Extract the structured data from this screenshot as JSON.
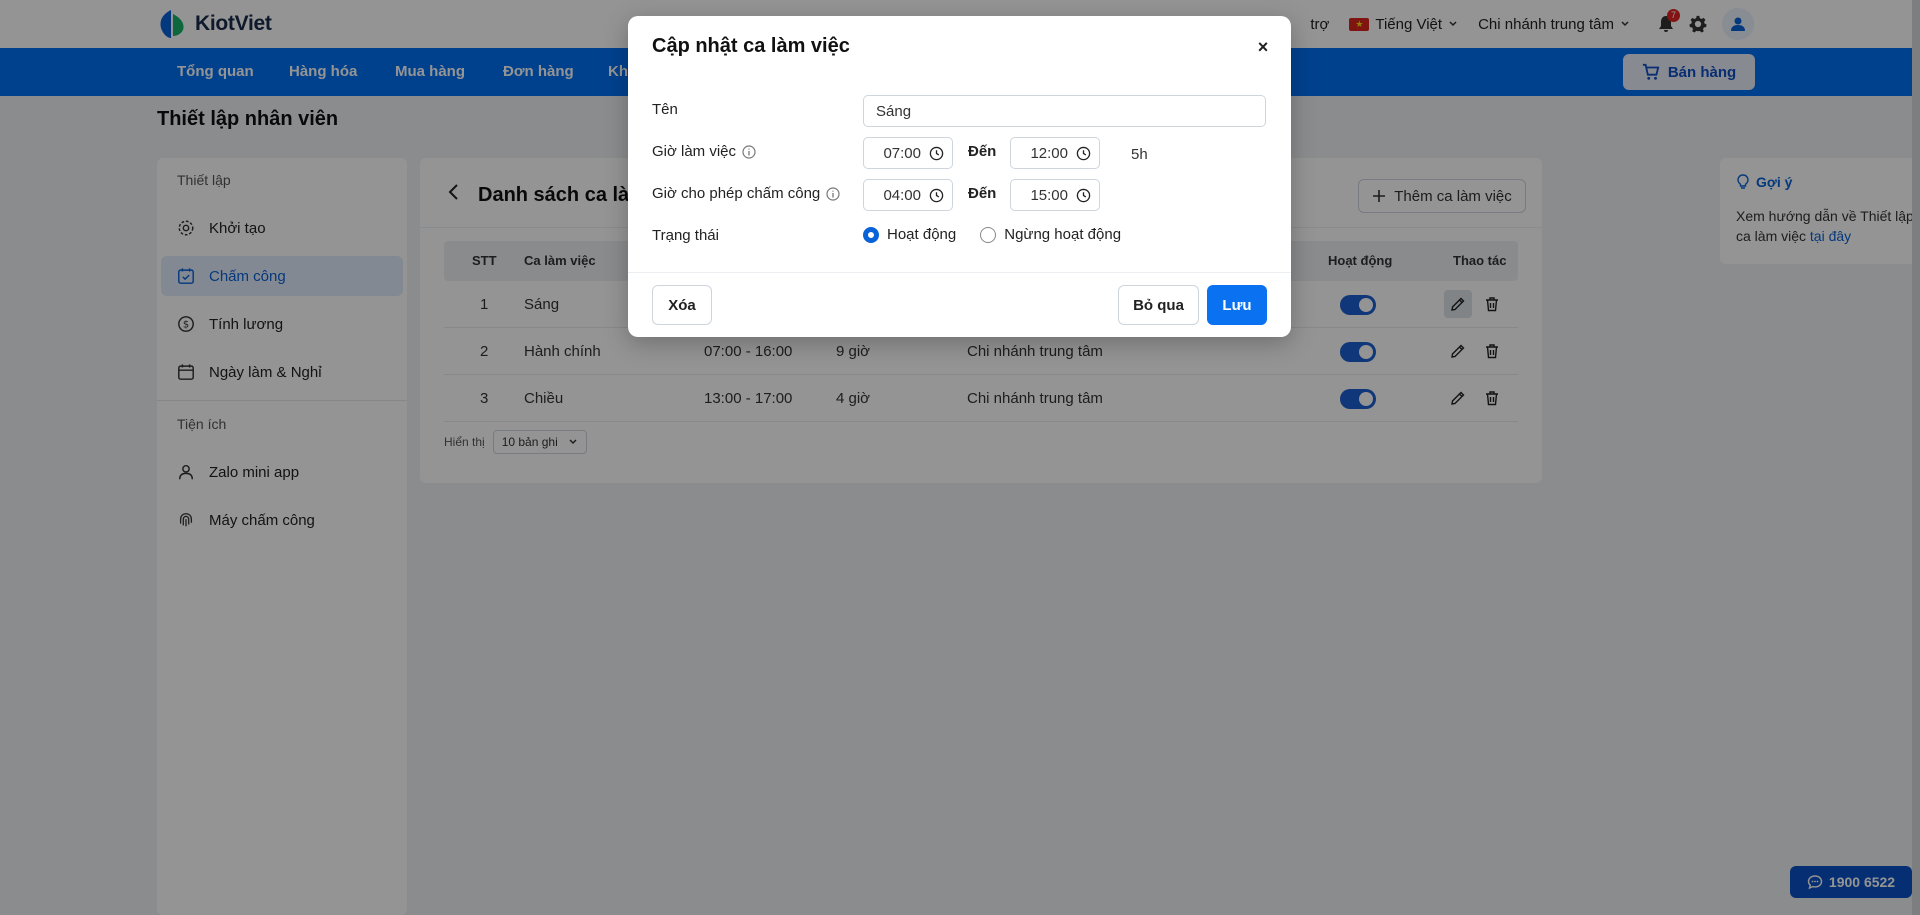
{
  "header": {
    "logo_text": "KiotViet",
    "support_label": "trợ",
    "language_label": "Tiếng Việt",
    "branch_label": "Chi nhánh trung tâm",
    "notification_count": "7"
  },
  "nav": {
    "items": [
      "Tổng quan",
      "Hàng hóa",
      "Mua hàng",
      "Đơn hàng",
      "Khá"
    ],
    "sell_label": "Bán hàng"
  },
  "page": {
    "title": "Thiết lập nhân viên"
  },
  "sidebar": {
    "section1": "Thiết lập",
    "items": [
      "Khởi tạo",
      "Chấm công",
      "Tính lương",
      "Ngày làm & Nghỉ"
    ],
    "section2": "Tiện ích",
    "utilities": [
      "Zalo mini app",
      "Máy chấm công"
    ]
  },
  "main": {
    "title": "Danh sách ca làm",
    "add_label": "Thêm ca làm việc",
    "columns": {
      "stt": "STT",
      "shift": "Ca làm việc",
      "active": "Hoạt động",
      "actions": "Thao tác"
    },
    "rows": [
      {
        "stt": "1",
        "name": "Sáng",
        "time": "",
        "hours": "",
        "branch": ""
      },
      {
        "stt": "2",
        "name": "Hành chính",
        "time": "07:00 - 16:00",
        "hours": "9 giờ",
        "branch": "Chi nhánh trung tâm"
      },
      {
        "stt": "3",
        "name": "Chiều",
        "time": "13:00 - 17:00",
        "hours": "4 giờ",
        "branch": "Chi nhánh trung tâm"
      }
    ],
    "pager_label": "Hiển thị",
    "pager_value": "10 bản ghi"
  },
  "hint": {
    "title": "Gợi ý",
    "body": "Xem hướng dẫn về Thiết lập ca làm việc",
    "link": "tại đây"
  },
  "hotline": "1900 6522",
  "modal": {
    "title": "Cập nhật ca làm việc",
    "close": "×",
    "name_label": "Tên",
    "name_value": "Sáng",
    "work_time_label": "Giờ làm việc",
    "work_from": "07:00",
    "to_label": "Đến",
    "work_to": "12:00",
    "duration": "5h",
    "checkin_label": "Giờ cho phép chấm công",
    "checkin_from": "04:00",
    "checkin_to": "15:00",
    "status_label": "Trạng thái",
    "status_active": "Hoạt động",
    "status_inactive": "Ngừng hoạt động",
    "delete_label": "Xóa",
    "cancel_label": "Bỏ qua",
    "save_label": "Lưu"
  }
}
